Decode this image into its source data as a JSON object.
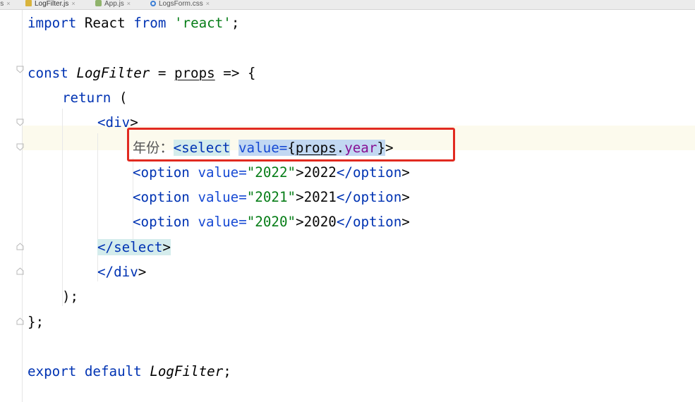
{
  "tabs": [
    {
      "label": "js",
      "icon": "js-file-icon",
      "active": false
    },
    {
      "label": "LogFilter.js",
      "icon": "js-file-icon",
      "active": true
    },
    {
      "label": "App.js",
      "icon": "react-file-icon",
      "active": false
    },
    {
      "label": "LogsForm.css",
      "icon": "css-file-icon",
      "active": false
    }
  ],
  "close_glyph": "×",
  "code": {
    "l1": {
      "kw_import": "import",
      "name": " React ",
      "kw_from": "from",
      "sp": " ",
      "str": "'react'",
      "end": ";"
    },
    "l3": {
      "kw_const": "const",
      "sp": " ",
      "fn": "LogFilter",
      "eq": " = ",
      "param": "props",
      "arrow": " => {"
    },
    "l4": {
      "kw_return": "return",
      "paren": " ("
    },
    "l5": {
      "open": "<div",
      "close": ">"
    },
    "l6": {
      "label": "年份：",
      "tag": "<select",
      "sp": " ",
      "attr": "value=",
      "brace_open": "{",
      "obj": "props",
      "dot": ".",
      "prop": "year",
      "brace_close": "}",
      "end": ">"
    },
    "options": [
      {
        "tag": "<option",
        "sp": " ",
        "attr": "value=",
        "val": "\"2022\"",
        "gt": ">",
        "text": "2022",
        "closetag": "</option",
        "end": ">"
      },
      {
        "tag": "<option",
        "sp": " ",
        "attr": "value=",
        "val": "\"2021\"",
        "gt": ">",
        "text": "2021",
        "closetag": "</option",
        "end": ">"
      },
      {
        "tag": "<option",
        "sp": " ",
        "attr": "value=",
        "val": "\"2020\"",
        "gt": ">",
        "text": "2020",
        "closetag": "</option",
        "end": ">"
      }
    ],
    "l10": {
      "closetag": "</select",
      "end": ">"
    },
    "l11": {
      "closetag": "</div",
      "end": ">"
    },
    "l12": {
      "text": ");"
    },
    "l13": {
      "text": "};"
    },
    "l15": {
      "kw_export": "export",
      "sp": " ",
      "kw_default": "default",
      "sp2": " ",
      "fn": "LogFilter",
      "end": ";"
    }
  },
  "colors": {
    "keyword": "#0033b3",
    "string": "#067d17",
    "property": "#871094",
    "annotation_box": "#e12a20",
    "caret_line": "#fcfaed"
  }
}
